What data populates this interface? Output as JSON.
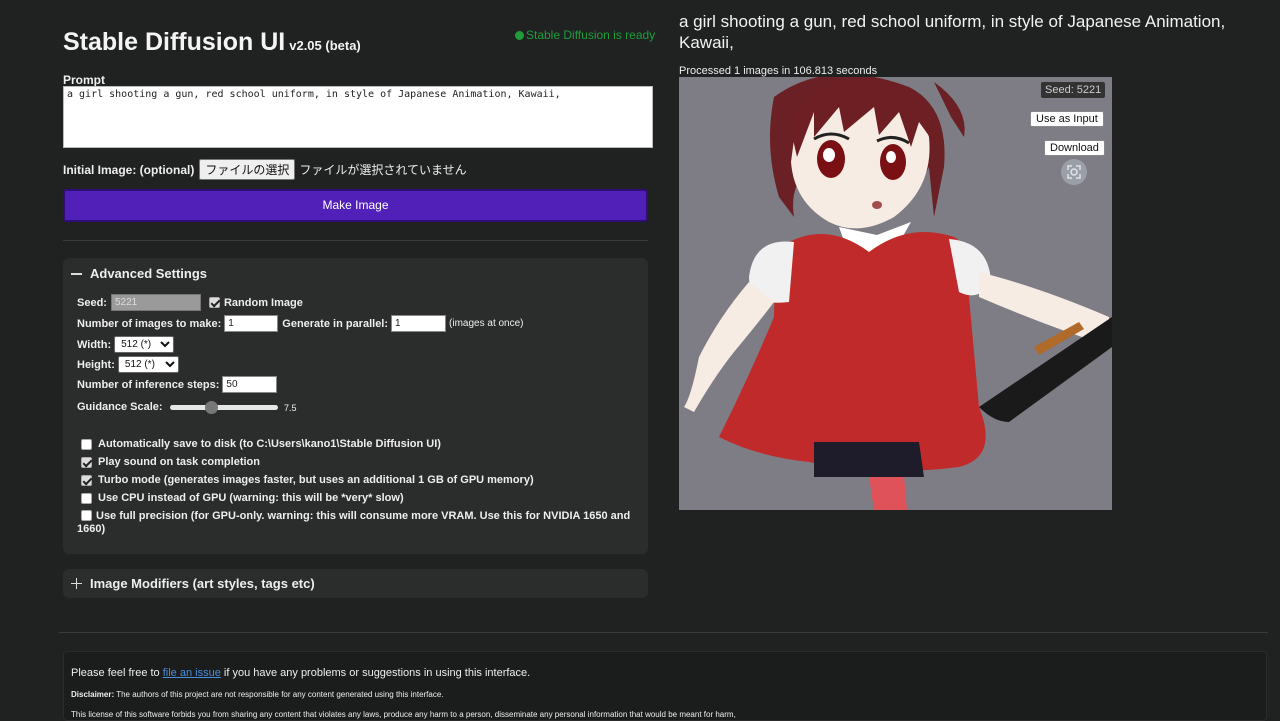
{
  "app": {
    "title": "Stable Diffusion UI",
    "version": "v2.05 (beta)",
    "status": "Stable Diffusion is ready",
    "status_color": "#1f9d3b",
    "accent": "#5020b8"
  },
  "prompt": {
    "label": "Prompt",
    "value": "a girl shooting a gun, red school uniform, in style of Japanese Animation, Kawaii,"
  },
  "initial_image": {
    "label": "Initial Image: (optional)",
    "button": "ファイルの選択",
    "status": "ファイルが選択されていません"
  },
  "make_image": "Make Image",
  "advanced": {
    "header": "Advanced Settings",
    "seed_label": "Seed:",
    "seed_value": "5221",
    "random_label": "Random Image",
    "random_checked": true,
    "num_images_label": "Number of images to make:",
    "num_images": "1",
    "parallel_label": "Generate in parallel:",
    "parallel": "1",
    "parallel_hint": "(images at once)",
    "width_label": "Width:",
    "width_value": "512 (*)",
    "height_label": "Height:",
    "height_value": "512 (*)",
    "steps_label": "Number of inference steps:",
    "steps": "50",
    "guidance_label": "Guidance Scale:",
    "guidance_value": "7.5",
    "guidance_fraction": 0.37,
    "options": [
      {
        "label": "Automatically save to disk (to C:\\Users\\kano1\\Stable Diffusion UI)",
        "checked": false
      },
      {
        "label": "Play sound on task completion",
        "checked": true
      },
      {
        "label": "Turbo mode (generates images faster, but uses an additional 1 GB of GPU memory)",
        "checked": true
      },
      {
        "label": "Use CPU instead of GPU (warning: this will be *very* slow)",
        "checked": false
      },
      {
        "label": "Use full precision (for GPU-only. warning: this will consume more VRAM. Use this for NVIDIA 1650 and 1660)",
        "checked": false
      }
    ]
  },
  "modifiers": {
    "header": "Image Modifiers (art styles, tags etc)"
  },
  "footer": {
    "line1_pre": "Please feel free to",
    "line1_link": "file an issue",
    "line1_post": "if you have any problems or suggestions in using this interface.",
    "disclaimer_label": "Disclaimer:",
    "disclaimer": "The authors of this project are not responsible for any content generated using this interface.",
    "license": "This license of this software forbids you from sharing any content that violates any laws, produce any harm to a person, disseminate any personal information that would be meant for harm,"
  },
  "output": {
    "prompt": "a girl shooting a gun, red school uniform, in style of Japanese Animation, Kawaii,",
    "processed": "Processed 1 images in 106.813 seconds",
    "seed_badge": "Seed: 5221",
    "use_as_input": "Use as Input",
    "download": "Download",
    "zoom_icon": "scan-zoom-icon"
  }
}
